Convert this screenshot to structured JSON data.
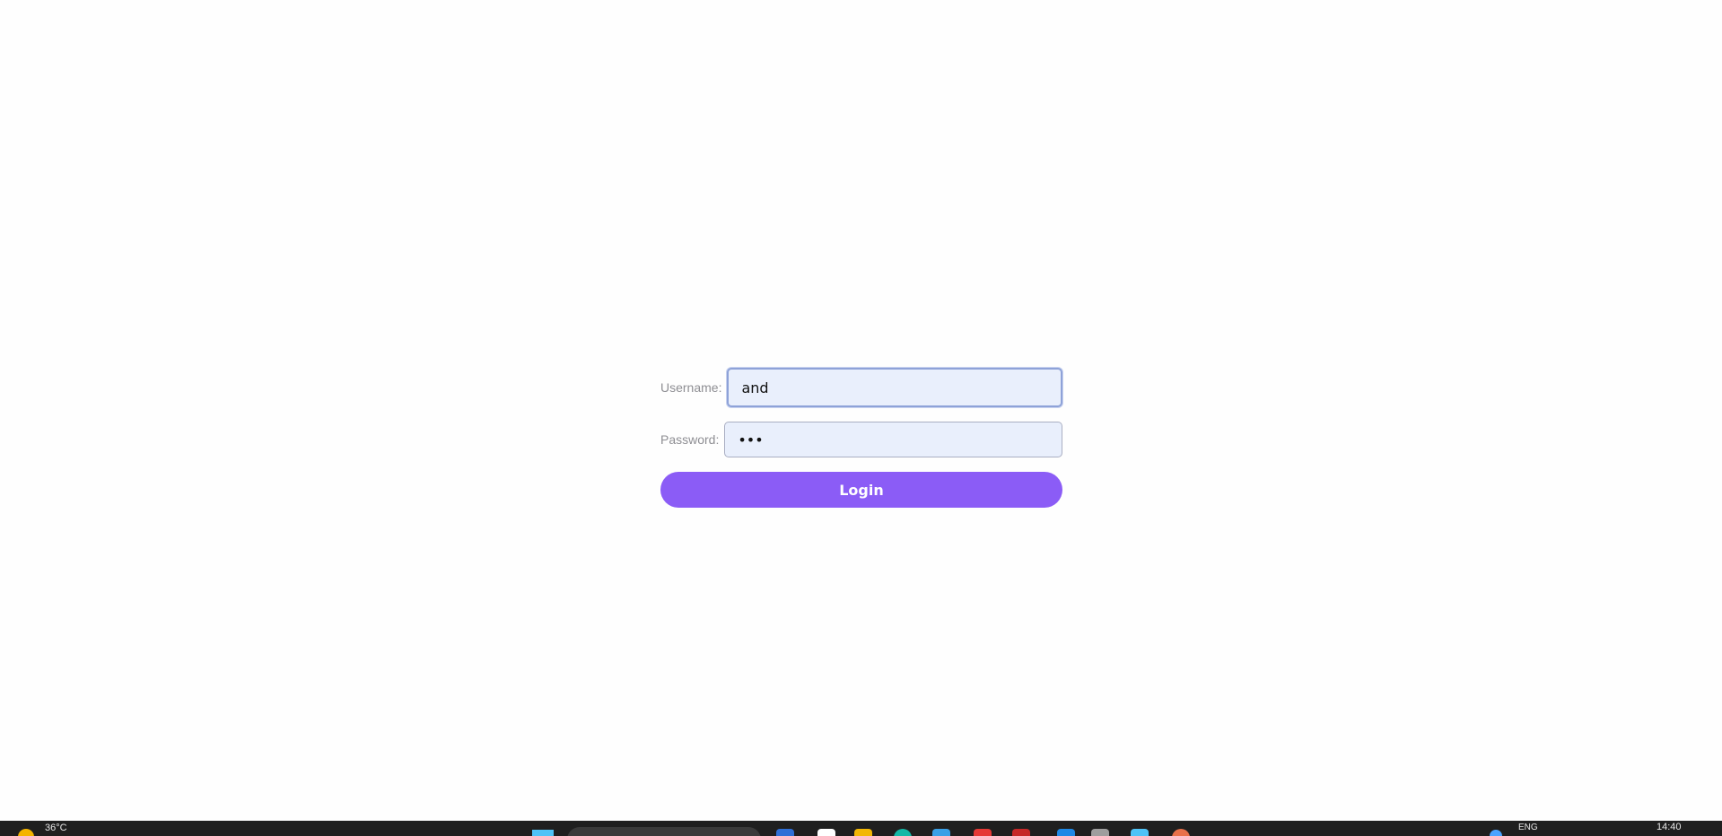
{
  "login": {
    "username_label": "Username:",
    "username_value": "and",
    "password_label": "Password:",
    "password_value": "abc",
    "login_label": "Login",
    "colors": {
      "button": "#8b5cf6",
      "input_bg": "#e9effc"
    }
  },
  "taskbar": {
    "temperature": "36°C",
    "language": "ENG",
    "time": "14:40",
    "icons": [
      "weather-icon",
      "start-icon",
      "search-box",
      "copilot-icon",
      "notepad-icon",
      "file-explorer-icon",
      "browser-icon",
      "store-icon",
      "mail-icon",
      "app-icon",
      "edge-icon",
      "terminal-icon",
      "photos-icon",
      "chrome-icon"
    ]
  }
}
